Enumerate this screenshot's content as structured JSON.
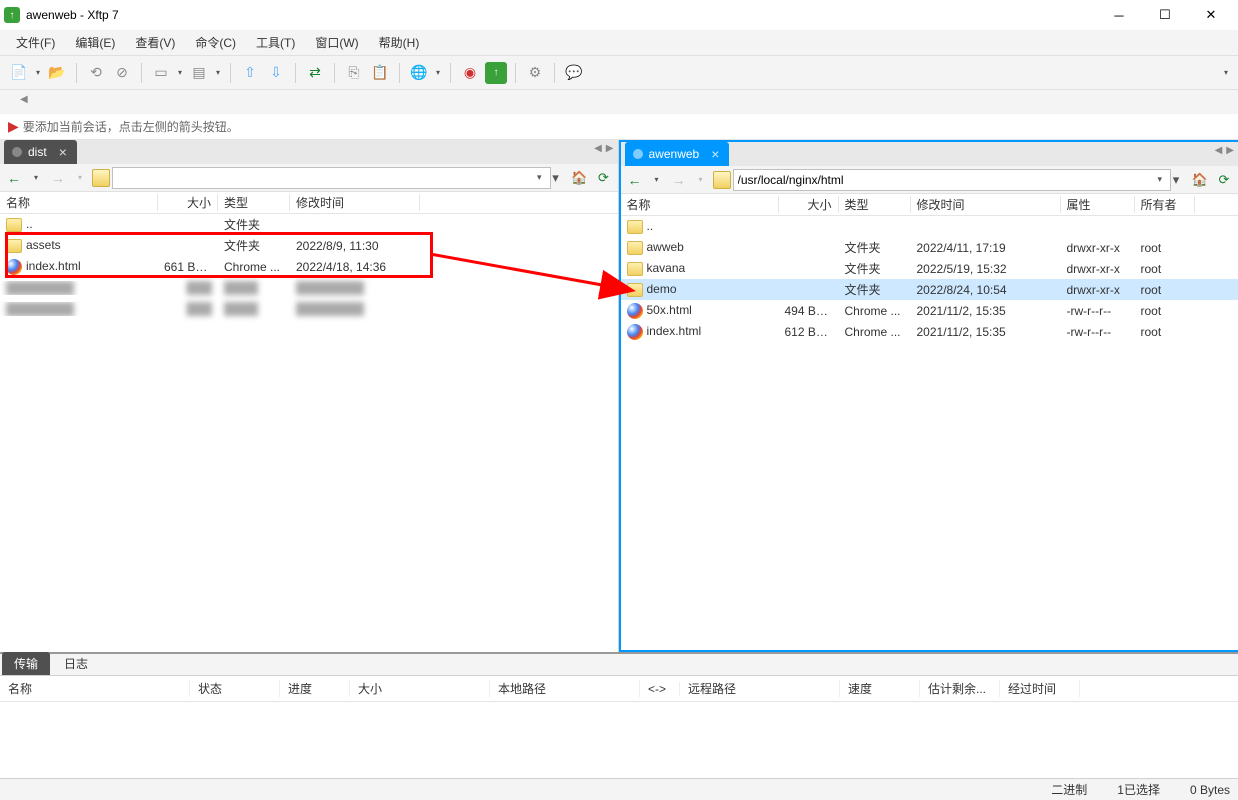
{
  "title": "awenweb - Xftp 7",
  "menu": {
    "file": "文件(F)",
    "edit": "编辑(E)",
    "view": "查看(V)",
    "command": "命令(C)",
    "tool": "工具(T)",
    "window": "窗口(W)",
    "help": "帮助(H)"
  },
  "hint": "要添加当前会话，点击左侧的箭头按钮。",
  "left": {
    "tab": "dist",
    "path": "",
    "headers": {
      "name": "名称",
      "size": "大小",
      "type": "类型",
      "date": "修改时间"
    },
    "rows": [
      {
        "icon": "folder",
        "name": "..",
        "size": "",
        "type": "文件夹",
        "date": ""
      },
      {
        "icon": "folder",
        "name": "assets",
        "size": "",
        "type": "文件夹",
        "date": "2022/8/9, 11:30"
      },
      {
        "icon": "html",
        "name": "index.html",
        "size": "661 Bytes",
        "type": "Chrome ...",
        "date": "2022/4/18, 14:36"
      }
    ]
  },
  "right": {
    "tab": "awenweb",
    "path": "/usr/local/nginx/html",
    "headers": {
      "name": "名称",
      "size": "大小",
      "type": "类型",
      "date": "修改时间",
      "perm": "属性",
      "owner": "所有者"
    },
    "rows": [
      {
        "icon": "folder",
        "name": "..",
        "size": "",
        "type": "",
        "date": "",
        "perm": "",
        "owner": "",
        "sel": false
      },
      {
        "icon": "folder",
        "name": "awweb",
        "size": "",
        "type": "文件夹",
        "date": "2022/4/11, 17:19",
        "perm": "drwxr-xr-x",
        "owner": "root",
        "sel": false
      },
      {
        "icon": "folder",
        "name": "kavana",
        "size": "",
        "type": "文件夹",
        "date": "2022/5/19, 15:32",
        "perm": "drwxr-xr-x",
        "owner": "root",
        "sel": false
      },
      {
        "icon": "folder",
        "name": "demo",
        "size": "",
        "type": "文件夹",
        "date": "2022/8/24, 10:54",
        "perm": "drwxr-xr-x",
        "owner": "root",
        "sel": true
      },
      {
        "icon": "html",
        "name": "50x.html",
        "size": "494 Bytes",
        "type": "Chrome ...",
        "date": "2021/11/2, 15:35",
        "perm": "-rw-r--r--",
        "owner": "root",
        "sel": false
      },
      {
        "icon": "html",
        "name": "index.html",
        "size": "612 Bytes",
        "type": "Chrome ...",
        "date": "2021/11/2, 15:35",
        "perm": "-rw-r--r--",
        "owner": "root",
        "sel": false
      }
    ]
  },
  "transfer": {
    "tabs": {
      "t1": "传输",
      "t2": "日志"
    },
    "headers": {
      "name": "名称",
      "status": "状态",
      "progress": "进度",
      "size": "大小",
      "local": "本地路径",
      "arrow": "<->",
      "remote": "远程路径",
      "speed": "速度",
      "estimate": "估计剩余...",
      "elapsed": "经过时间"
    }
  },
  "status": {
    "mode": "二进制",
    "sel": "1已选择",
    "size": "0 Bytes"
  }
}
